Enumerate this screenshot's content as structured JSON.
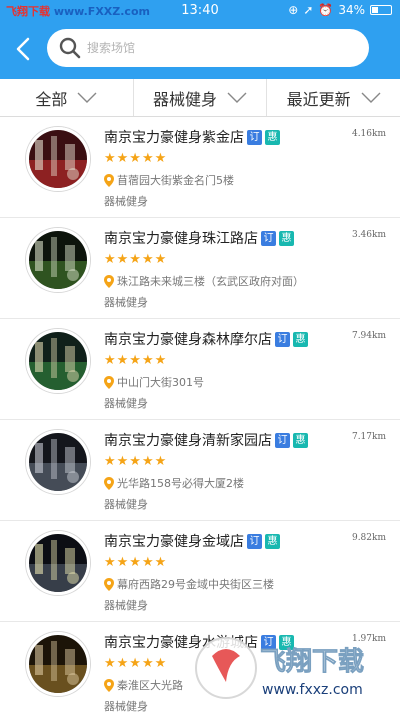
{
  "status_bar": {
    "site_label_a": "飞翔下载",
    "site_label_b": "www.FXXZ.com",
    "time": "13:40",
    "battery": "34%"
  },
  "header": {
    "search_placeholder": "搜索场馆"
  },
  "filters": [
    {
      "label": "全部"
    },
    {
      "label": "器械健身"
    },
    {
      "label": "最近更新"
    }
  ],
  "gyms": [
    {
      "name": "南京宝力豪健身紫金店",
      "distance": "4.16km",
      "address": "苜蓿园大街紫金名门5楼",
      "category": "器械健身",
      "tag_ding": "订",
      "tag_hui": "惠",
      "stars": "★★★★★",
      "rating": 5
    },
    {
      "name": "南京宝力豪健身珠江路店",
      "distance": "3.46km",
      "address": "珠江路未来城三楼（玄武区政府对面）",
      "category": "器械健身",
      "tag_ding": "订",
      "tag_hui": "惠",
      "stars": "★★★★★",
      "rating": 5
    },
    {
      "name": "南京宝力豪健身森林摩尔店",
      "distance": "7.94km",
      "address": "中山门大街301号",
      "category": "器械健身",
      "tag_ding": "订",
      "tag_hui": "惠",
      "stars": "★★★★★",
      "rating": 5
    },
    {
      "name": "南京宝力豪健身清新家园店",
      "distance": "7.17km",
      "address": "光华路158号必得大厦2楼",
      "category": "器械健身",
      "tag_ding": "订",
      "tag_hui": "惠",
      "stars": "★★★★★",
      "rating": 5
    },
    {
      "name": "南京宝力豪健身金域店",
      "distance": "9.82km",
      "address": "幕府西路29号金域中央街区三楼",
      "category": "器械健身",
      "tag_ding": "订",
      "tag_hui": "惠",
      "stars": "★★★★★",
      "rating": 5
    },
    {
      "name": "南京宝力豪健身水游城店",
      "distance": "1.97km",
      "address": "秦淮区大光路",
      "category": "器械健身",
      "tag_ding": "订",
      "tag_hui": "惠",
      "stars": "★★★★★",
      "rating": 5
    }
  ],
  "watermark": {
    "text_cn": "飞翔下载",
    "text_url": "www.fxxz.com"
  },
  "colors": {
    "header_blue": "#2fa0f0",
    "star_orange": "#f5a417",
    "tag_ding": "#3a7de0",
    "tag_hui": "#18b8b0"
  }
}
